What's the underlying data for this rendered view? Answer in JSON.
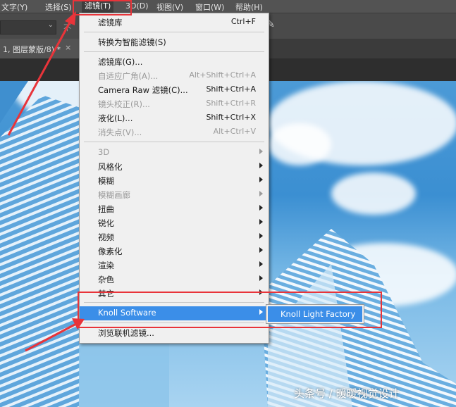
{
  "menubar": {
    "items": [
      {
        "label": "文字(Y)"
      },
      {
        "label": "选择(S)"
      },
      {
        "label": "滤镜(T)"
      },
      {
        "label": "3D(D)"
      },
      {
        "label": "视图(V)"
      },
      {
        "label": "窗口(W)"
      },
      {
        "label": "帮助(H)"
      }
    ]
  },
  "options_bar": {
    "text": "不"
  },
  "document_tab": {
    "label": "1, 图层蒙版/8) *",
    "close": "×"
  },
  "filter_menu": {
    "items": [
      {
        "label": "滤镜库",
        "shortcut": "Ctrl+F"
      },
      {
        "label": "转换为智能滤镜(S)"
      },
      {
        "label": "滤镜库(G)..."
      },
      {
        "label": "自适应广角(A)...",
        "shortcut": "Alt+Shift+Ctrl+A"
      },
      {
        "label": "Camera Raw 滤镜(C)...",
        "shortcut": "Shift+Ctrl+A"
      },
      {
        "label": "镜头校正(R)...",
        "shortcut": "Shift+Ctrl+R"
      },
      {
        "label": "液化(L)...",
        "shortcut": "Shift+Ctrl+X"
      },
      {
        "label": "消失点(V)...",
        "shortcut": "Alt+Ctrl+V"
      },
      {
        "label": "3D"
      },
      {
        "label": "风格化"
      },
      {
        "label": "模糊"
      },
      {
        "label": "模糊画廊"
      },
      {
        "label": "扭曲"
      },
      {
        "label": "锐化"
      },
      {
        "label": "视频"
      },
      {
        "label": "像素化"
      },
      {
        "label": "渲染"
      },
      {
        "label": "杂色"
      },
      {
        "label": "其它"
      },
      {
        "label": "Knoll Software"
      },
      {
        "label": "浏览联机滤镜..."
      }
    ]
  },
  "submenu": {
    "label": "Knoll Light Factory"
  },
  "watermark": "头条号 / 暖暖视觉设计",
  "colors": {
    "highlight": "#3b8ee8",
    "annotation": "#e8343a",
    "menu_bg": "#f0f0f0"
  }
}
